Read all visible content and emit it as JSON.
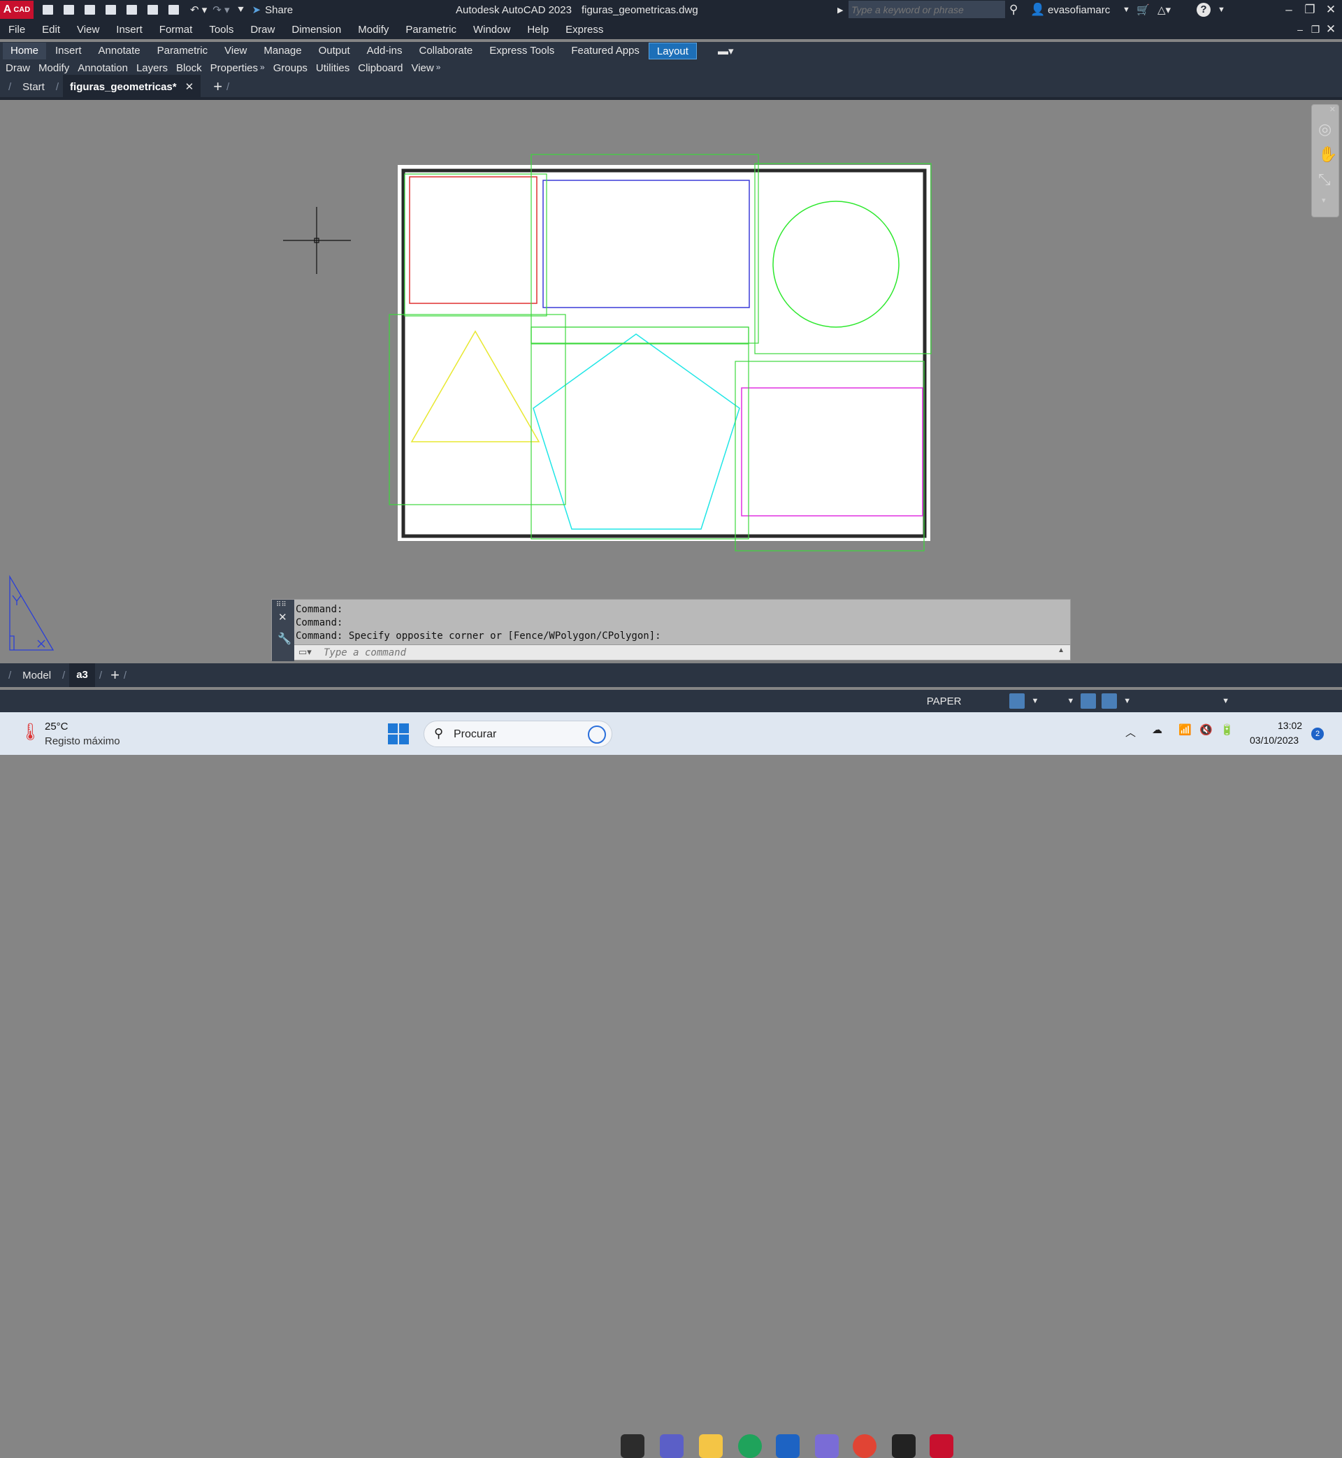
{
  "titlebar": {
    "app_badge": "CAD",
    "share_label": "Share",
    "title": "Autodesk AutoCAD 2023",
    "filename": "figuras_geometricas.dwg",
    "search_placeholder": "Type a keyword or phrase",
    "username": "evasofiamarc"
  },
  "menu": [
    "File",
    "Edit",
    "View",
    "Insert",
    "Format",
    "Tools",
    "Draw",
    "Dimension",
    "Modify",
    "Parametric",
    "Window",
    "Help",
    "Express"
  ],
  "ribbon_tabs": [
    "Home",
    "Insert",
    "Annotate",
    "Parametric",
    "View",
    "Manage",
    "Output",
    "Add-ins",
    "Collaborate",
    "Express Tools",
    "Featured Apps",
    "Layout"
  ],
  "panels": [
    "Draw",
    "Modify",
    "Annotation",
    "Layers",
    "Block",
    "Properties",
    "Groups",
    "Utilities",
    "Clipboard",
    "View"
  ],
  "doc_tabs": {
    "start": "Start",
    "active": "figuras_geometricas*"
  },
  "command": {
    "lines": [
      "Command:",
      "Command:",
      "Command: Specify opposite corner or [Fence/WPolygon/CPolygon]:"
    ],
    "placeholder": "Type a command"
  },
  "layout_tabs": {
    "model": "Model",
    "layout": "a3"
  },
  "status": {
    "space": "PAPER"
  },
  "taskbar": {
    "temperature": "25°C",
    "weather": "Registo máximo",
    "search": "Procurar",
    "time": "13:02",
    "date": "03/10/2023",
    "notifications": "2"
  },
  "colors": {
    "red": "#e03030",
    "blue": "#3a3ad8",
    "green": "#2ee82e",
    "yellow": "#e8e830",
    "cyan": "#20e6e6",
    "magenta": "#e030e0",
    "selection": "#3cd83c"
  }
}
